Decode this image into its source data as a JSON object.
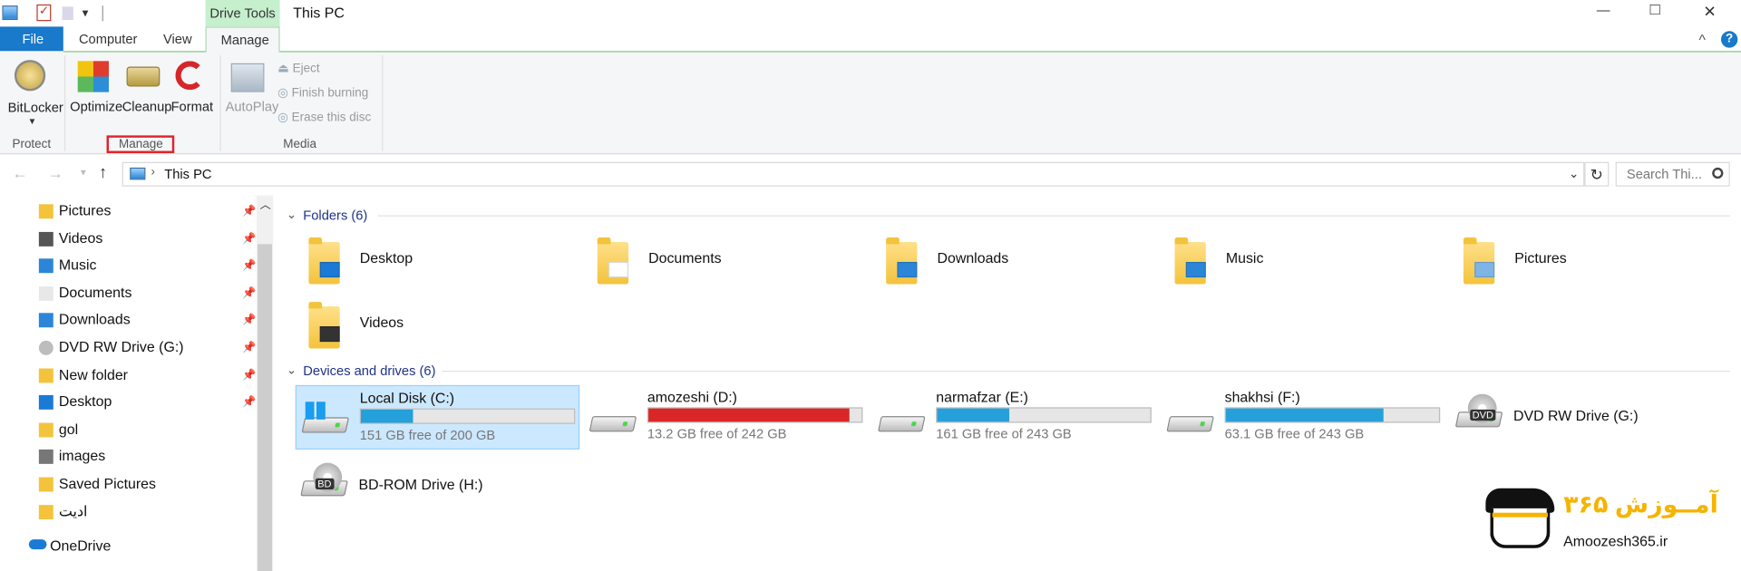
{
  "window": {
    "title": "This PC",
    "minimize": "—",
    "maximize": "□",
    "close": "✕"
  },
  "qat": {
    "dropdown": "▾"
  },
  "ribbon": {
    "context_label": "Drive Tools",
    "tabs": [
      "File",
      "Computer",
      "View",
      "Manage"
    ],
    "help": "?",
    "collapse": "^",
    "buttons": {
      "bitlocker": "BitLocker",
      "optimize": "Optimize",
      "cleanup": "Cleanup",
      "format": "Format",
      "autoplay": "AutoPlay",
      "eject": "Eject",
      "finish_burning": "Finish burning",
      "erase": "Erase this disc"
    },
    "groups": {
      "protect": "Protect",
      "manage": "Manage",
      "media": "Media"
    }
  },
  "address": {
    "path": "This PC",
    "search_placeholder": "Search Thi..."
  },
  "sidebar": {
    "items": [
      {
        "label": "Pictures",
        "icon": "pictures-icon"
      },
      {
        "label": "Videos",
        "icon": "videos-icon"
      },
      {
        "label": "Music",
        "icon": "music-icon"
      },
      {
        "label": "Documents",
        "icon": "documents-icon"
      },
      {
        "label": "Downloads",
        "icon": "downloads-icon"
      },
      {
        "label": "DVD RW Drive (G:)",
        "icon": "dvd-drive-icon"
      },
      {
        "label": "New folder",
        "icon": "folder-icon"
      },
      {
        "label": "Desktop",
        "icon": "desktop-icon"
      },
      {
        "label": "gol",
        "icon": "folder-icon"
      },
      {
        "label": "images",
        "icon": "images-icon"
      },
      {
        "label": "Saved Pictures",
        "icon": "folder-icon"
      },
      {
        "label": "ادیت",
        "icon": "folder-icon"
      }
    ],
    "onedrive": "OneDrive"
  },
  "folders": {
    "header": "Folders (6)",
    "items": [
      "Desktop",
      "Documents",
      "Downloads",
      "Music",
      "Pictures",
      "Videos"
    ]
  },
  "drives": {
    "header": "Devices and drives (6)",
    "items": [
      {
        "name": "Local Disk (C:)",
        "free": "151 GB free of 200 GB",
        "used_fraction": 0.245,
        "color": "#26a0da"
      },
      {
        "name": "amozeshi (D:)",
        "free": "13.2 GB free of 242 GB",
        "used_fraction": 0.945,
        "color": "#da2626"
      },
      {
        "name": "narmafzar (E:)",
        "free": "161 GB free of 243 GB",
        "used_fraction": 0.337,
        "color": "#26a0da"
      },
      {
        "name": "shakhsi (F:)",
        "free": "63.1 GB free of 243 GB",
        "used_fraction": 0.74,
        "color": "#26a0da"
      },
      {
        "name": "DVD RW Drive (G:)"
      },
      {
        "name": "BD-ROM Drive (H:)"
      }
    ]
  },
  "watermark": {
    "site": "Amoozesh365.ir",
    "brand": "آمــوزش ۳۶۵"
  },
  "colors": {
    "accent": "#1979ca",
    "context": "#c6efce",
    "selection": "#cce8ff"
  }
}
